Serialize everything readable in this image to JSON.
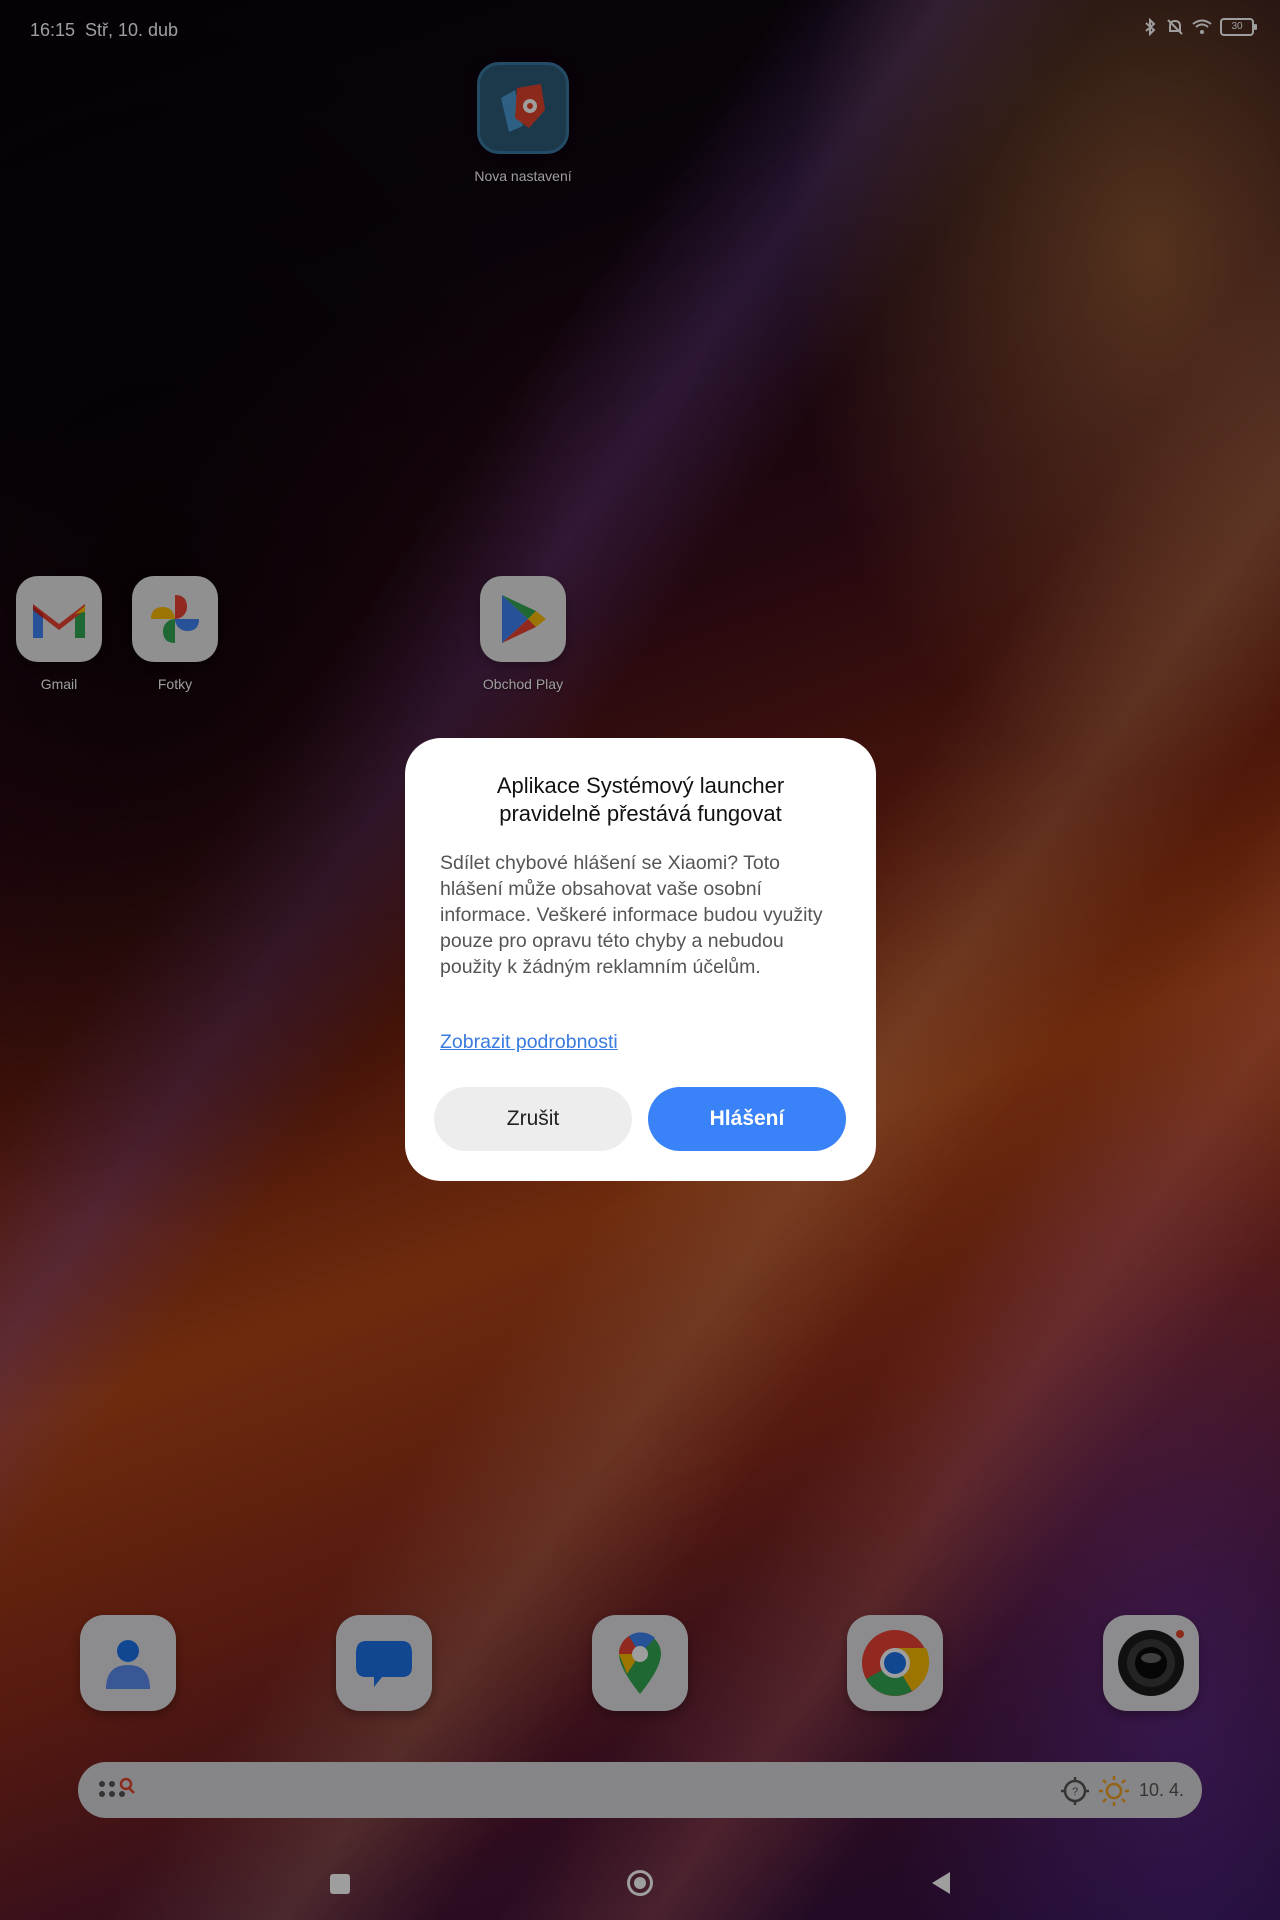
{
  "status_bar": {
    "time": "16:15",
    "date": "Stř, 10. dub",
    "battery": "30",
    "icons": [
      "bluetooth-icon",
      "mute-icon",
      "wifi-icon",
      "battery-icon"
    ]
  },
  "home_apps": [
    {
      "label": "Nova nastavení",
      "icon": "nova-settings-icon"
    },
    {
      "label": "Gmail",
      "icon": "gmail-icon"
    },
    {
      "label": "Fotky",
      "icon": "photos-icon"
    },
    {
      "label": "Obchod Play",
      "icon": "play-store-icon"
    }
  ],
  "dock": [
    "contacts-icon",
    "messages-icon",
    "maps-icon",
    "chrome-icon",
    "camera-icon"
  ],
  "search_bar": {
    "date": "10. 4.",
    "icons": [
      "app-drawer-search-icon",
      "location-icon",
      "weather-sun-icon"
    ]
  },
  "dialog": {
    "title": "Aplikace Systémový launcher pravidelně přestává fungovat",
    "body": "Sdílet chybové hlášení se Xiaomi? Toto hlášení může obsahovat vaše osobní informace. Veškeré informace budou využity pouze pro opravu této chyby a nebudou použity k žádným reklamním účelům.",
    "link": "Zobrazit podrobnosti",
    "cancel_label": "Zrušit",
    "report_label": "Hlášení",
    "accent_color": "#3a82f7"
  },
  "nav_bar": [
    "recents-button",
    "home-button",
    "back-button"
  ]
}
